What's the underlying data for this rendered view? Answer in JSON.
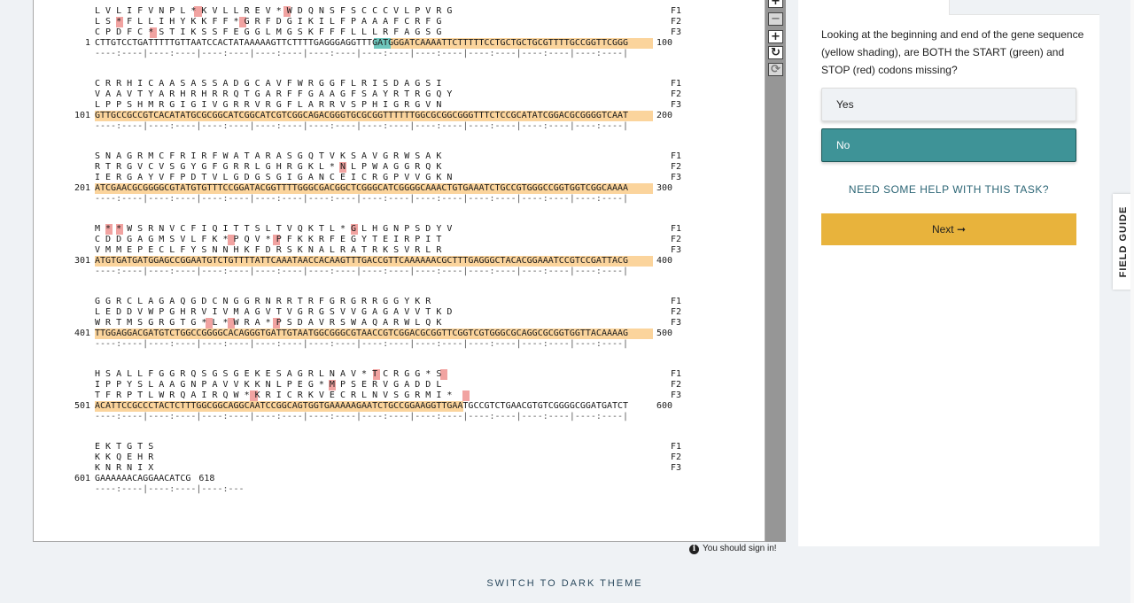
{
  "sequence": {
    "blocks": [
      {
        "F1": "L V L I F V N P L * K V L L R E V * W D Q N S F S C C C V L P V R G",
        "F2": "L S * F L L I H Y K K F F * G R F D G I K I L F P A A A F C R F G",
        "F3": "C P D F C * S T I K S S F E G G L M G S K F F F L L L R F A G S G",
        "num": "1",
        "dna": "CTTGTCCTGATTTTTGTTAATCCACTATAAAAAGTTCTTTTGAGGGAGGTTTGATGGGATCAAAATTCTTTTTCCTGCTGCTGCGTTTTGCCGGTTCGGG",
        "end": "100"
      },
      {
        "F1": "C R R H I C A A S A S S A D G C A V F W R G G F L R I S D A G S I",
        "F2": "V A A V T Y A R H R H R R Q T G A R F F G A A G F S A Y R T R G Q Y",
        "F3": "L P P S H M R G I G I V G R R V R G F L A R R V S P H I G R G V N",
        "num": "101",
        "dna": "GTTGCCGCCGTCACATATGCGCGGCATCGGCATCGTCGGCAGACGGGTGCGCGGTTTTTTGGCGCGGCGGGTTTCTCCGCATATCGGACGCGGGGTCAAT",
        "end": "200"
      },
      {
        "F1": "S N A G R M C F R I R F W A T A R A S G Q T V K S A V G R W S A K",
        "F2": "R T R G V C V S G Y G F G R R L G H R G K L * N L P W A G G R Q K",
        "F3": "I E R G A Y V F P D T V L G D G S G I G A N C E I C R G P V V G K N",
        "num": "201",
        "dna": "ATCGAACGCGGGGCGTATGTGTTTCCGGATACGGTTTTGGGCGACGGCTCGGGCATCGGGGCAAACTGTGAAATCTGCCGTGGGCCGGTGGTCGGCAAAA",
        "end": "300"
      },
      {
        "F1": "M * * W S R N V C F I Q I T T S L T V Q K T L * G L H G N P S D Y V",
        "F2": "C D D G A G M S V L F K * P Q V * P F K K R F E G Y T E I R P I T",
        "F3": "V M M E P E C L F Y S N N H K F D R S K N A L R A T R K S V R L R",
        "num": "301",
        "dna": "ATGTGATGATGGAGCCGGAATGTCTGTTTTATTCAAATAACCACAAGTTTGACCGTTCAAAAAACGCTTTGAGGGCTACACGGAAATCCGTCCGATTACG",
        "end": "400"
      },
      {
        "F1": "G G R C L A G A Q G D C N G G R N R R T R F G R G R R G G Y K R",
        "F2": "L E D D V W P G H R V I V M A G V T V G R G S V V G A G A V V T K D",
        "F3": "W R T M S G R G T G * L * W R A * P S D A V R S W A Q A R W L Q K",
        "num": "401",
        "dna": "TTGGAGGACGATGTCTGGCCGGGGCACAGGGTGATTGTAATGGCGGGCGTAACCGTCGGACGCGGTTCGGTCGTGGGCGCAGGCGCGGTGGTTACAAAAG",
        "end": "500"
      },
      {
        "F1": "H S A L L F G G R Q S G S G E K E S A G R L N A V * T C R G G * S",
        "F2": "I P P Y S L A A G N P A V V K K N L P E G * M P S E R V G A D D L",
        "F3": "T F R P T L W R Q A I R Q W * K R I C R K V E C R L N V S G R M I *",
        "num": "501",
        "dna": "ACATTCCGCCCTACTCTTTGGCGGCAGGCAATCCGGCAGTGGTGAAAAAGAATCTGCCGGAAGGTTGAATGCCGTCTGAACGTGTCGGGGCGGATGATCT",
        "end": "600"
      },
      {
        "F1": "E K T G T S",
        "F2": "K K Q E H R",
        "F3": "K N R N I X",
        "num": "601",
        "dna": "GAAAAAACAGGAACATCG",
        "end": "618"
      }
    ],
    "frame_labels": [
      "F1",
      "F2",
      "F3"
    ],
    "ruler_full": "----:----|----:----|----:----|----:----|----:----|----:----|----:----|----:----|----:----|----:----|",
    "ruler_last": "----:----|----:----|----:---"
  },
  "toolbar": {
    "pan_icon": "move-icon",
    "zoom_out_label": "−",
    "zoom_in_label": "+",
    "rotate_label": "↻",
    "reset_label": "⟳"
  },
  "signin": {
    "icon": "i",
    "text": "You should sign in!"
  },
  "theme_toggle": "SWITCH TO DARK THEME",
  "task": {
    "question": "Looking at the beginning and end of the gene sequence (yellow shading), are BOTH the START (green) and STOP (red) codons missing?",
    "answers": [
      {
        "label": "Yes",
        "selected": false
      },
      {
        "label": "No",
        "selected": true
      }
    ],
    "help": "NEED SOME HELP WITH THIS TASK?",
    "next": "Next ➞"
  },
  "field_guide": "FIELD GUIDE",
  "colors": {
    "gene_fill": "#fbd49c",
    "start_codon": "#6ec6bd",
    "stop_codon": "#f1a3a1",
    "selected_answer": "#3e9397",
    "next_button": "#e8b33c"
  }
}
